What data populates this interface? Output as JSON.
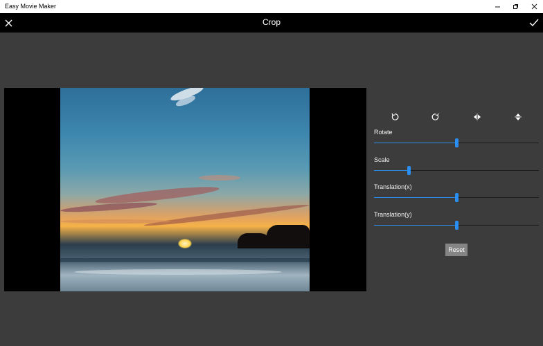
{
  "window": {
    "title": "Easy Movie Maker"
  },
  "header": {
    "title": "Crop"
  },
  "toolbar": {
    "tools": [
      {
        "name": "rotate-left-icon"
      },
      {
        "name": "rotate-right-icon"
      },
      {
        "name": "flip-horizontal-icon"
      },
      {
        "name": "flip-vertical-icon"
      }
    ]
  },
  "controls": {
    "rotate": {
      "label": "Rotate",
      "value": 0.5
    },
    "scale": {
      "label": "Scale",
      "value": 0.21
    },
    "translation_x": {
      "label": "Translation(x)",
      "value": 0.5
    },
    "translation_y": {
      "label": "Translation(y)",
      "value": 0.5
    },
    "reset_label": "Reset"
  },
  "colors": {
    "accent": "#2a8ff0",
    "background": "#3c3c3c",
    "topbar": "#000000"
  }
}
